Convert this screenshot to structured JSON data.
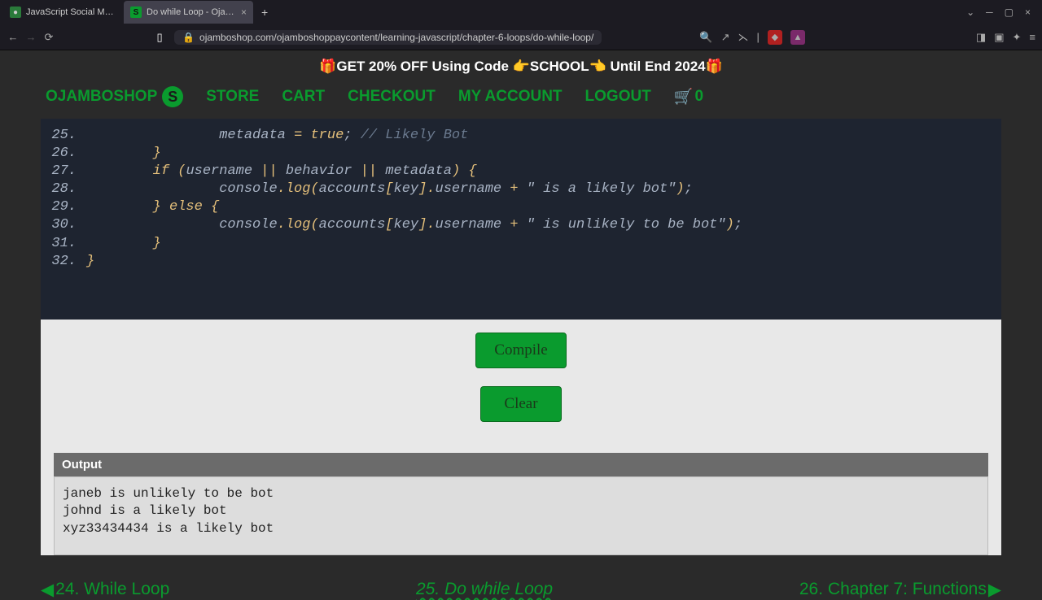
{
  "browser": {
    "tabs": [
      {
        "title": "JavaScript Social Media Bot De",
        "favicon_bg": "#2a7a3a"
      },
      {
        "title": "Do while Loop - OjamboSh...",
        "favicon_bg": "#0a9b2e",
        "favicon_letter": "S"
      }
    ],
    "url": "ojamboshop.com/ojamboshoppaycontent/learning-javascript/chapter-6-loops/do-while-loop/"
  },
  "promo": "🎁GET 20% OFF Using Code 👉SCHOOL👈 Until End 2024🎁",
  "nav": {
    "logo": "OJAMBOSHOP",
    "logo_letter": "S",
    "store": "STORE",
    "cart": "CART",
    "checkout": "CHECKOUT",
    "account": "MY ACCOUNT",
    "logout": "LOGOUT",
    "cart_count": "0"
  },
  "code_lines": [
    {
      "num": "25.",
      "raw": "                metadata = true; // Likely Bot"
    },
    {
      "num": "26.",
      "raw": "        }"
    },
    {
      "num": "27.",
      "raw": "        if (username || behavior || metadata) {"
    },
    {
      "num": "28.",
      "raw": "                console.log(accounts[key].username + \" is a likely bot\");"
    },
    {
      "num": "29.",
      "raw": "        } else {"
    },
    {
      "num": "30.",
      "raw": "                console.log(accounts[key].username + \" is unlikely to be bot\");"
    },
    {
      "num": "31.",
      "raw": "        }"
    },
    {
      "num": "32.",
      "raw": "}"
    }
  ],
  "buttons": {
    "compile": "Compile",
    "clear": "Clear"
  },
  "output": {
    "header": "Output",
    "lines": [
      "janeb is unlikely to be bot",
      "johnd is a likely bot",
      "xyz33434434 is a likely bot"
    ]
  },
  "pagination": {
    "prev": "24. While Loop",
    "current": "25. Do while Loop",
    "next": "26. Chapter 7: Functions"
  }
}
